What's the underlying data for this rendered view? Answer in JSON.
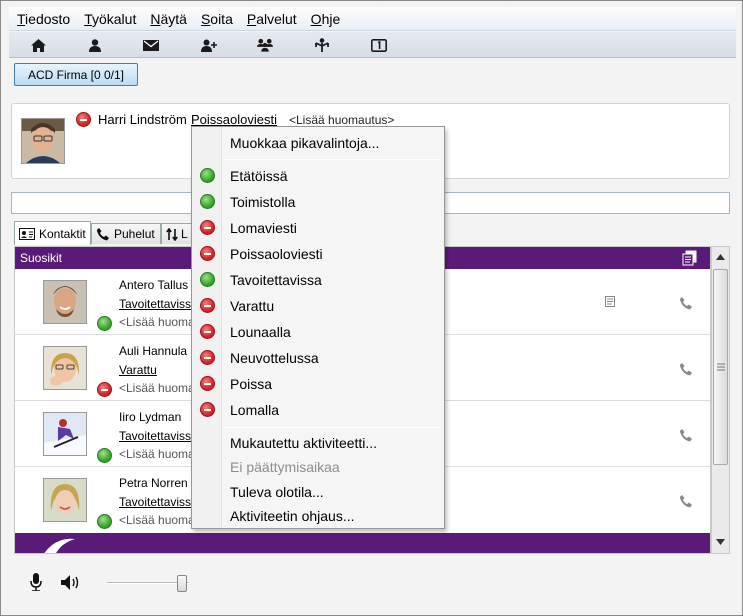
{
  "menubar": {
    "items": [
      {
        "first": "T",
        "rest": "iedosto"
      },
      {
        "first": "T",
        "rest": "yökalut"
      },
      {
        "first": "N",
        "rest": "äytä"
      },
      {
        "first": "S",
        "rest": "oita"
      },
      {
        "first": "P",
        "rest": "alvelut"
      },
      {
        "first": "O",
        "rest": "hje"
      }
    ]
  },
  "toolbar": {
    "icons": [
      "home-icon",
      "person-icon",
      "mail-icon",
      "add-contact-icon",
      "group-icon",
      "organization-icon",
      "calendar-icon"
    ]
  },
  "acd": {
    "label": "ACD Firma [0 0/1]"
  },
  "profile": {
    "name": "Harri Lindström",
    "status": "Poissaoloviesti",
    "note": "<Lisää huomautus>"
  },
  "search": {
    "value": ""
  },
  "tabs": [
    {
      "label": "Kontaktit",
      "icon": "contacts-card-icon"
    },
    {
      "label": "Puhelut",
      "icon": "phone-icon"
    },
    {
      "label": "L",
      "icon": "sort-arrows-icon"
    }
  ],
  "list": {
    "group_label": "Suosikit",
    "contacts": [
      {
        "name": "Antero Tallus",
        "status": "Tavoitettavissa",
        "status_color": "green",
        "note": "<Lisää huomautus>"
      },
      {
        "name": "Auli Hannula",
        "status": "Varattu",
        "status_color": "red",
        "note": "<Lisää huomautus>"
      },
      {
        "name": "Iiro Lydman",
        "status": "Tavoitettavissa",
        "status_color": "green",
        "note": "<Lisää huomautus>"
      },
      {
        "name": "Petra Norren",
        "status": "Tavoitettavissa",
        "status_color": "green",
        "note": "<Lisää huomautus>"
      }
    ]
  },
  "popup": {
    "edit_shortcuts": "Muokkaa pikavalintoja...",
    "statuses": [
      {
        "label": "Etätöissä",
        "color": "green"
      },
      {
        "label": "Toimistolla",
        "color": "green"
      },
      {
        "label": "Lomaviesti",
        "color": "red"
      },
      {
        "label": "Poissaoloviesti",
        "color": "red"
      },
      {
        "label": "Tavoitettavissa",
        "color": "green"
      },
      {
        "label": "Varattu",
        "color": "red"
      },
      {
        "label": "Lounaalla",
        "color": "red"
      },
      {
        "label": "Neuvottelussa",
        "color": "red"
      },
      {
        "label": "Poissa",
        "color": "red"
      },
      {
        "label": "Lomalla",
        "color": "red"
      }
    ],
    "custom_activity": "Mukautettu aktiviteetti...",
    "no_end_time": "Ei päättymisaikaa",
    "upcoming_presence": "Tuleva olotila...",
    "activity_routing": "Aktiviteetin ohjaus..."
  },
  "colors": {
    "group_bg": "#5a1a78",
    "available": "#3aa62c",
    "busy": "#d4262a"
  },
  "volume": {
    "level_percent": 85
  }
}
